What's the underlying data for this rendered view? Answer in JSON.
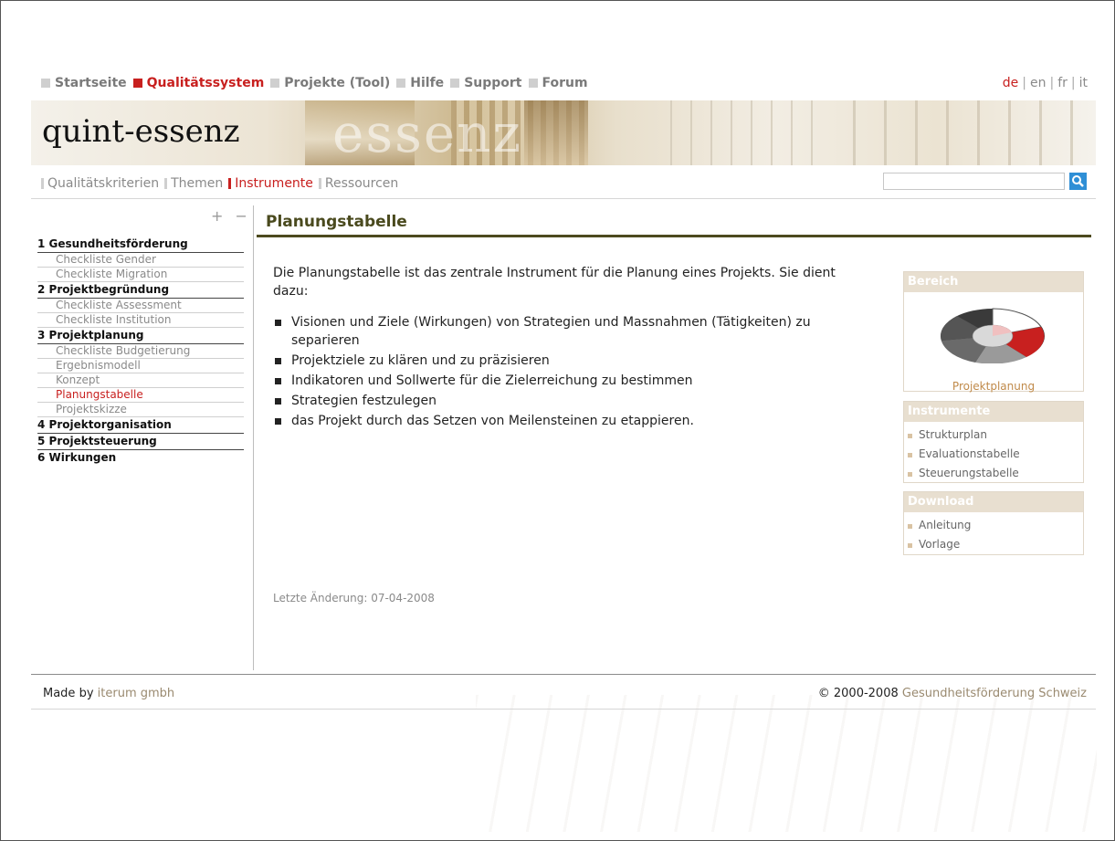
{
  "colors": {
    "accent": "#c8201f",
    "title": "#4a4a1e",
    "link": "#9a8a70",
    "box_header": "#e8dfd0"
  },
  "topnav": {
    "items": [
      {
        "label": "Startseite",
        "active": false
      },
      {
        "label": "Qualitätssystem",
        "active": true
      },
      {
        "label": "Projekte (Tool)",
        "active": false
      },
      {
        "label": "Hilfe",
        "active": false
      },
      {
        "label": "Support",
        "active": false
      },
      {
        "label": "Forum",
        "active": false
      }
    ],
    "languages": [
      "de",
      "en",
      "fr",
      "it"
    ],
    "active_language": "de"
  },
  "banner": {
    "logo": "quint-essenz",
    "ghost": "essenz"
  },
  "subnav": {
    "items": [
      {
        "label": "Qualitätskriterien",
        "active": false
      },
      {
        "label": "Themen",
        "active": false
      },
      {
        "label": "Instrumente",
        "active": true
      },
      {
        "label": "Ressourcen",
        "active": false
      }
    ]
  },
  "search": {
    "value": "",
    "icon": "search-icon"
  },
  "sidebar": {
    "controls": "+ −",
    "sections": [
      {
        "label": "1 Gesundheitsförderung",
        "items": [
          "Checkliste Gender",
          "Checkliste Migration"
        ]
      },
      {
        "label": "2 Projektbegründung",
        "items": [
          "Checkliste Assessment",
          "Checkliste Institution"
        ]
      },
      {
        "label": "3 Projektplanung",
        "items": [
          "Checkliste Budgetierung",
          "Ergebnismodell",
          "Konzept",
          "Planungstabelle",
          "Projektskizze"
        ]
      },
      {
        "label": "4 Projektorganisation",
        "items": []
      },
      {
        "label": "5 Projektsteuerung",
        "items": []
      },
      {
        "label": "6 Wirkungen",
        "items": []
      }
    ],
    "active_item": "Planungstabelle"
  },
  "main": {
    "title": "Planungstabelle",
    "intro": "Die Planungstabelle ist das zentrale Instrument für die Planung eines Projekts. Sie dient dazu:",
    "bullets": [
      "Visionen und Ziele (Wirkungen) von Strategien und Massnahmen (Tätigkeiten) zu separieren",
      "Projektziele zu klären und zu präzisieren",
      "Indikatoren und Sollwerte für die Zielerreichung zu bestimmen",
      "Strategien festzulegen",
      "das Projekt durch das Setzen von Meilensteinen zu etappieren."
    ],
    "last_change": "Letzte Änderung: 07-04-2008"
  },
  "right": {
    "bereich": {
      "header": "Bereich",
      "caption": "Projektplanung"
    },
    "instrumente": {
      "header": "Instrumente",
      "items": [
        "Strukturplan",
        "Evaluationstabelle",
        "Steuerungstabelle"
      ]
    },
    "download": {
      "header": "Download",
      "items": [
        "Anleitung",
        "Vorlage"
      ]
    }
  },
  "footer": {
    "made_by_prefix": "Made by",
    "made_by_link": "iterum gmbh",
    "copyright_prefix": "© 2000-2008",
    "copyright_link": "Gesundheitsförderung Schweiz"
  }
}
